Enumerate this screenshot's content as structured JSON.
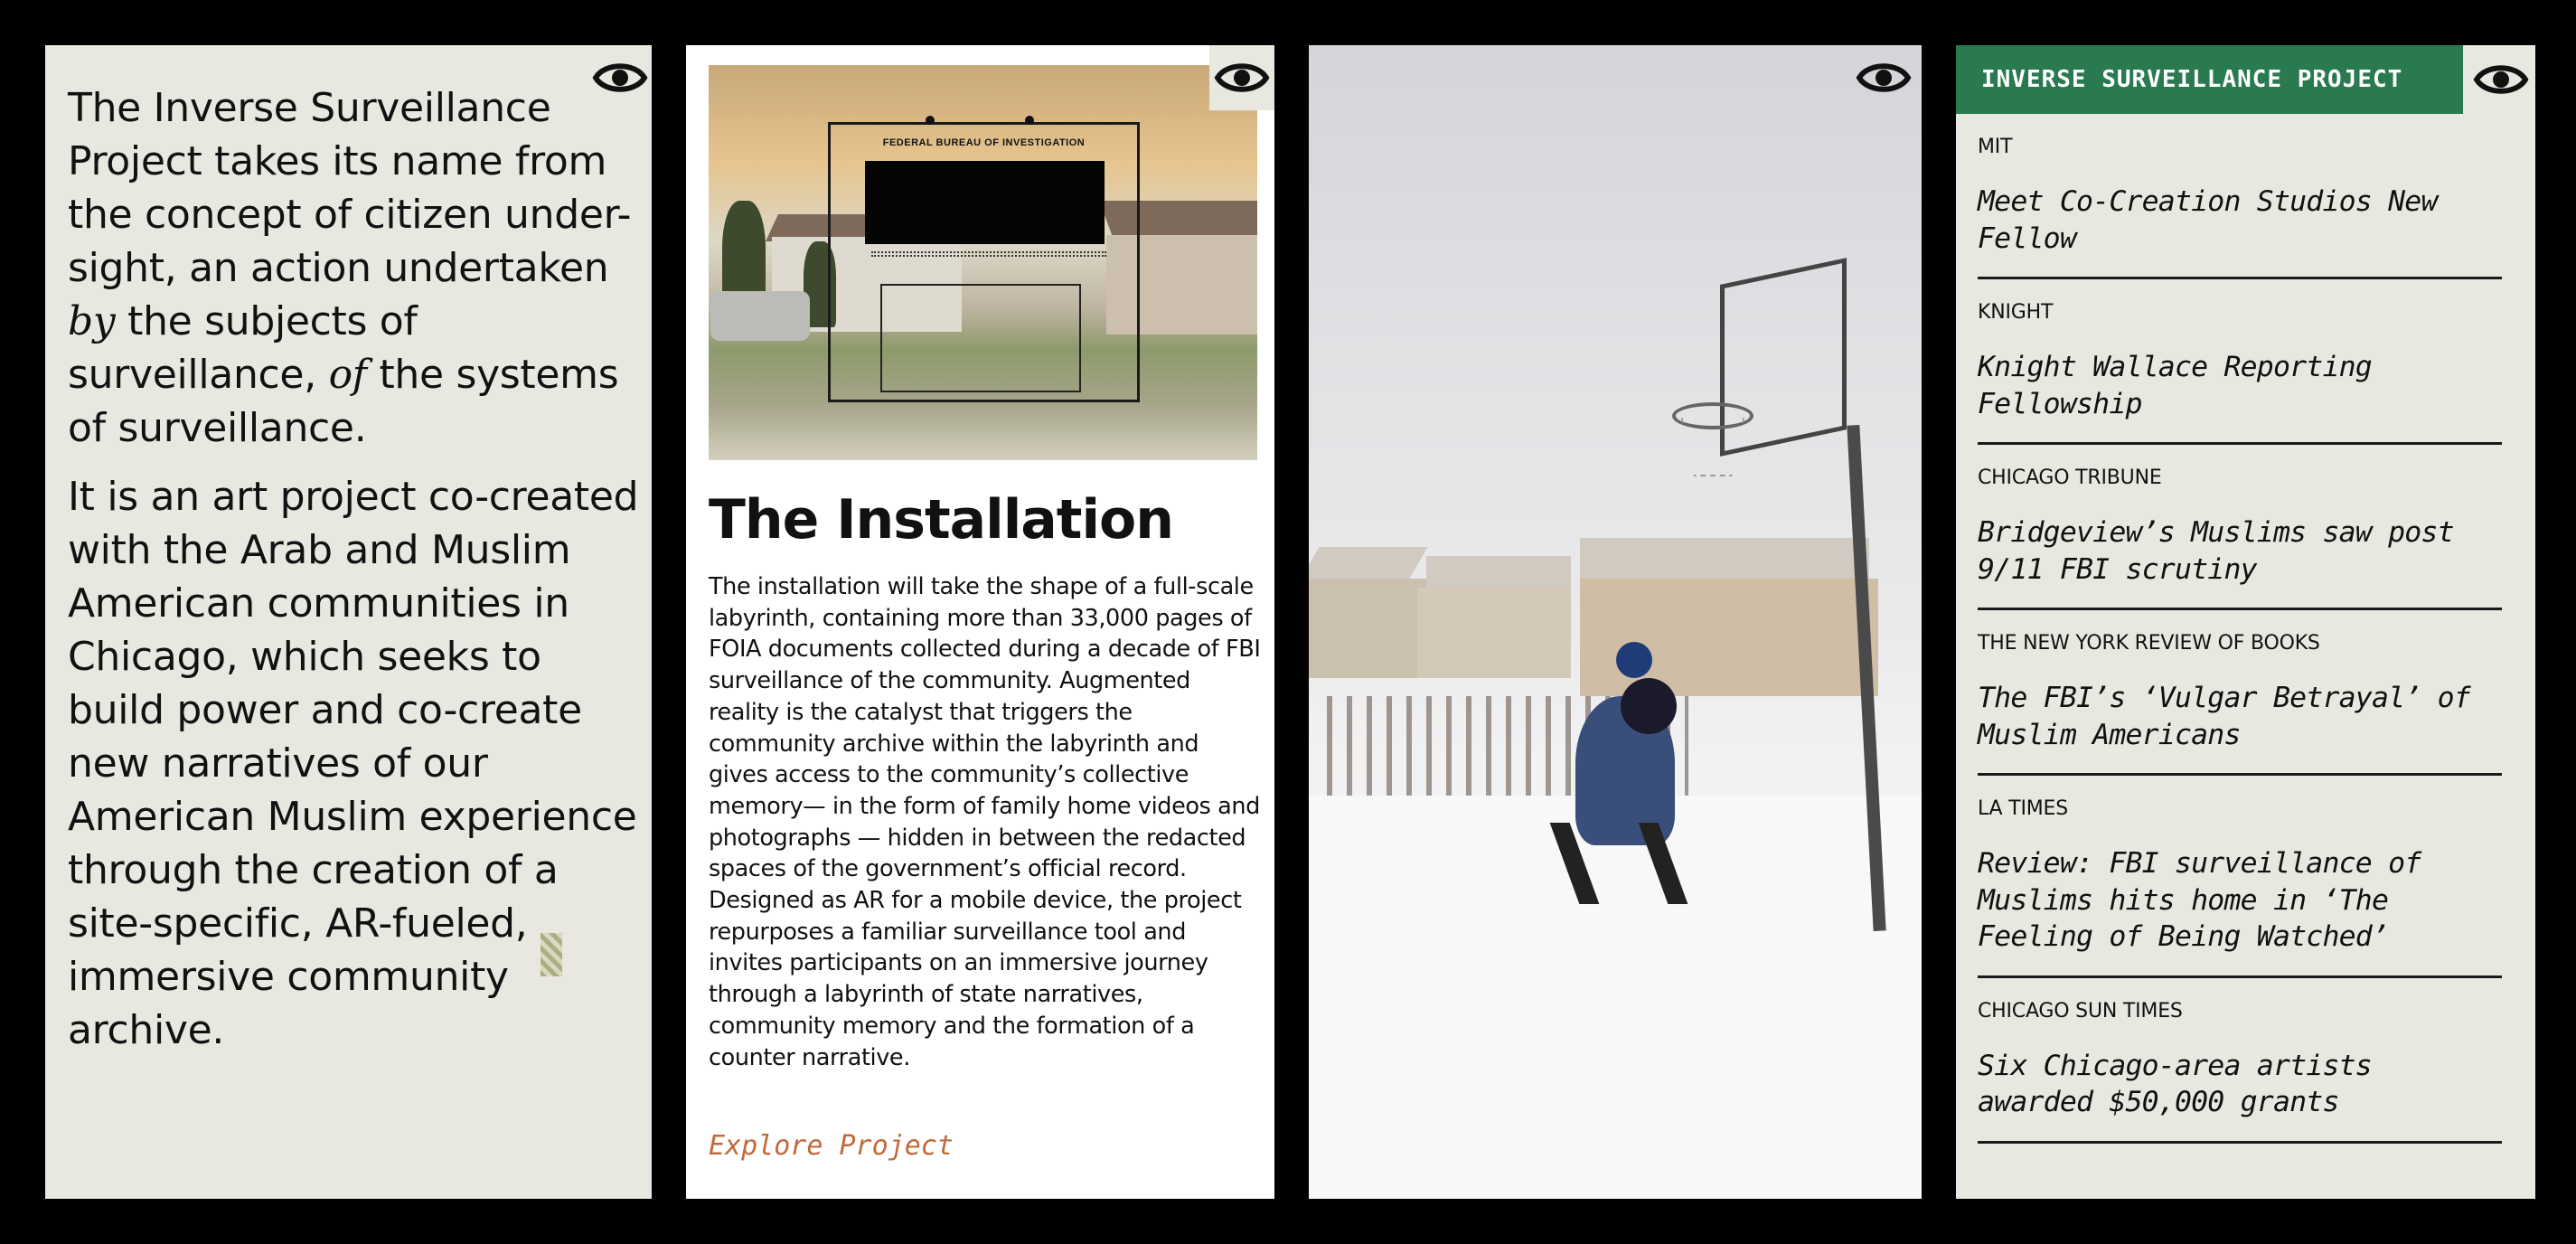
{
  "colors": {
    "panel_bg": "#e9e8e0",
    "brand_green": "#2a7a4f",
    "link_orange": "#c06a3a",
    "frame": "#000000"
  },
  "icons": {
    "eye": "eye-icon"
  },
  "intro": {
    "p1_a": "The Inverse Surveillance Project takes its name from the concept of citizen under-sight, an action undertaken ",
    "p1_em1": "by",
    "p1_b": " the subjects of surveillance, ",
    "p1_em2": "of",
    "p1_c": " the systems of surveillance.",
    "p2": "It is an art project co-created with the Arab and Muslim American communities in Chicago, which seeks to build power and co-create new narratives of our American Muslim experience through the creation of a site-specific, AR-fueled, immersive community archive."
  },
  "installation": {
    "document_header": "FEDERAL BUREAU OF INVESTIGATION",
    "title": "The Installation",
    "body": "The installation will take the shape of a full-scale labyrinth, containing more than 33,000 pages of FOIA documents collected during a decade of FBI surveillance of the community. Augmented reality is the catalyst that triggers the community archive within the labyrinth and gives access to the community’s collective memory— in the form of family home videos and photographs — hidden in between the redacted spaces of the government’s official record. Designed as AR for a mobile device, the project repurposes a familiar surveillance tool and invites participants on an immersive journey through a labyrinth of state narratives, community memory and the formation of a counter narrative.",
    "cta": "Explore Project"
  },
  "press": {
    "brand": "INVERSE SURVEILLANCE PROJECT",
    "items": [
      {
        "source": "MIT",
        "title": "Meet Co-Creation Studios New Fellow"
      },
      {
        "source": "KNIGHT",
        "title": "Knight Wallace Reporting Fellowship"
      },
      {
        "source": "CHICAGO TRIBUNE",
        "title": "Bridgeview’s Muslims saw post 9/11 FBI scrutiny"
      },
      {
        "source": "THE NEW YORK REVIEW OF BOOKS",
        "title": "The FBI’s ‘Vulgar Betrayal’ of Muslim Americans"
      },
      {
        "source": "LA TIMES",
        "title": "Review: FBI surveillance of Muslims hits home in ‘The Feeling of Being Watched’"
      },
      {
        "source": "CHICAGO SUN TIMES",
        "title": "Six Chicago-area artists awarded $50,000 grants"
      }
    ]
  }
}
